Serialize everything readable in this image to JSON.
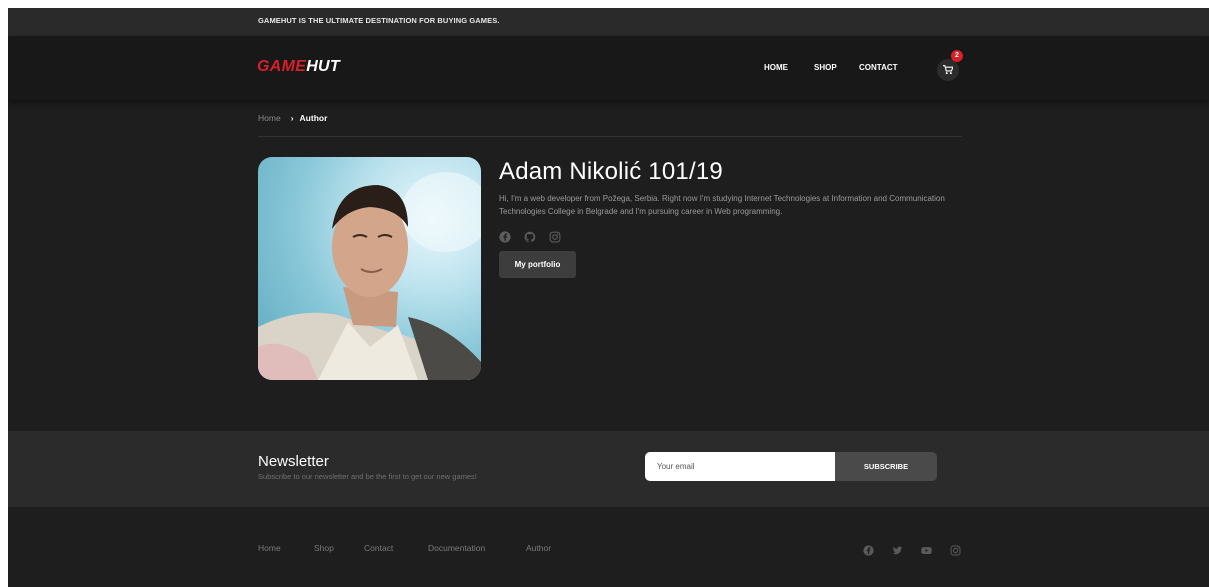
{
  "topbar": {
    "text": "GAMEHUT IS THE ULTIMATE DESTINATION FOR BUYING GAMES."
  },
  "header": {
    "logo_part1": "GAME",
    "logo_part2": "HUT",
    "nav": [
      "HOME",
      "SHOP",
      "CONTACT"
    ],
    "cart_count": "2",
    "cart_icon": "shopping-cart-icon"
  },
  "breadcrumb": {
    "home": "Home",
    "separator": "›",
    "current": "Author"
  },
  "author": {
    "name": "Adam Nikolić 101/19",
    "bio": "Hi, I'm a web developer from Požega, Serbia. Right now I'm studying Internet Technologies at Information and Communication Technologies College in Belgrade and I'm pursuing career in Web programming.",
    "socials": [
      "facebook-icon",
      "github-icon",
      "instagram-icon"
    ],
    "portfolio_button": "My portfolio"
  },
  "newsletter": {
    "title": "Newsletter",
    "subtitle": "Subscribe to our newsletter and be the first to get our new games!",
    "email_placeholder": "Your email",
    "subscribe_label": "SUBSCRIBE"
  },
  "footer": {
    "links": [
      "Home",
      "Shop",
      "Contact",
      "Documentation",
      "Author"
    ],
    "socials": [
      "facebook-icon",
      "twitter-icon",
      "youtube-icon",
      "instagram-icon"
    ]
  },
  "colors": {
    "accent": "#d8202a",
    "background": "#1e1e1e",
    "panel": "#2b2b2b"
  }
}
